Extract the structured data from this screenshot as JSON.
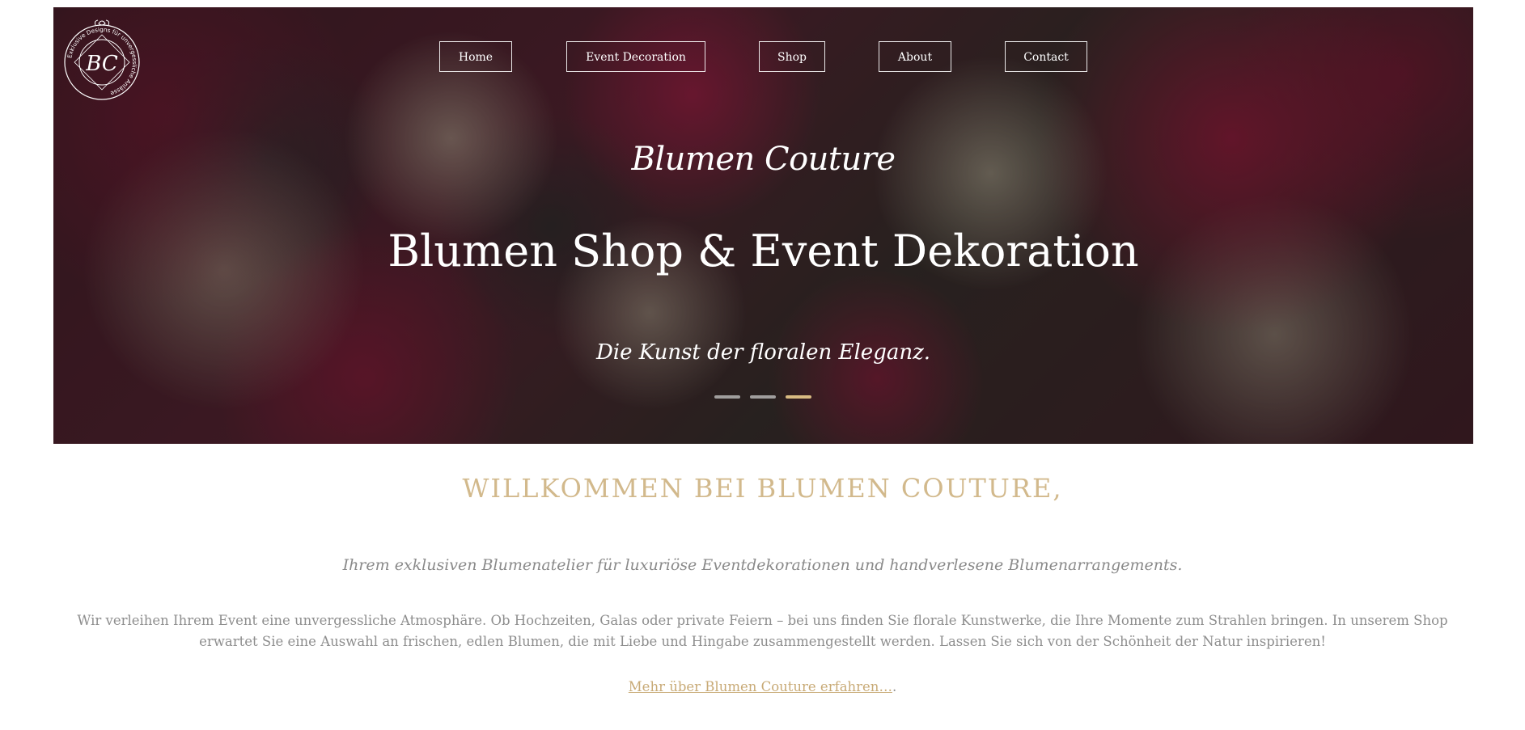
{
  "nav": {
    "items": [
      {
        "label": "Home"
      },
      {
        "label": "Event Decoration"
      },
      {
        "label": "Shop"
      },
      {
        "label": "About"
      },
      {
        "label": "Contact"
      }
    ]
  },
  "logo": {
    "initials": "BC",
    "ring_text": "Exklusive Designs für unvergessliche Anlässe"
  },
  "hero": {
    "script_title": "Blumen Couture",
    "title": "Blumen Shop & Event Dekoration",
    "tagline": "Die Kunst der floralen Eleganz.",
    "slides_total": 3,
    "active_slide": 3
  },
  "welcome": {
    "heading": "WILLKOMMEN BEI BLUMEN COUTURE,",
    "intro": "Ihrem exklusiven Blumenatelier für luxuriöse Eventdekorationen und handverlesene Blumenarrangements.",
    "body": "Wir verleihen Ihrem Event eine unvergessliche Atmosphäre. Ob Hochzeiten, Galas oder private Feiern – bei uns finden Sie florale Kunstwerke, die Ihre Momente zum Strahlen bringen. In unserem Shop erwartet Sie eine Auswahl an frischen, edlen Blumen, die mit Liebe und Hingabe zusammengestellt werden. Lassen Sie sich von der Schönheit der Natur inspirieren!",
    "more_link": "Mehr über Blumen Couture erfahren…",
    "more_suffix": "."
  },
  "colors": {
    "accent_gold": "#d2b98c",
    "link_gold": "#c8aa76",
    "body_gray": "#8e8e8e",
    "active_dot": "#d8bb82"
  }
}
